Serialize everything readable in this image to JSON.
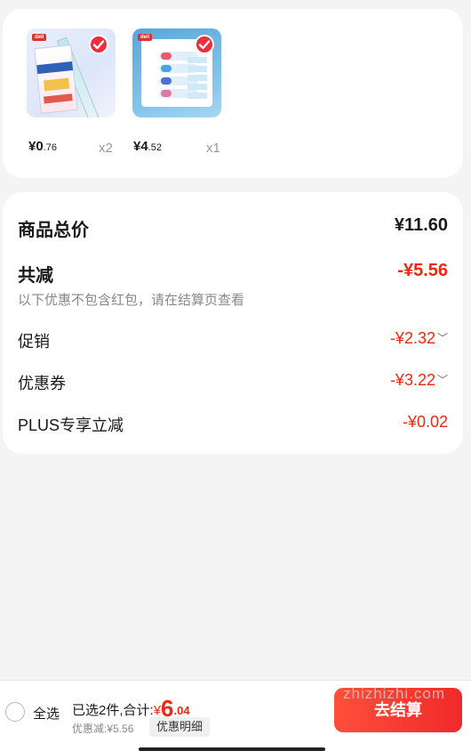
{
  "products": [
    {
      "price_symbol": "¥",
      "price_int": "0",
      "price_dec": ".76",
      "qty": "x2",
      "image": "ruler-set-product",
      "brand": "deli"
    },
    {
      "price_symbol": "¥",
      "price_int": "4",
      "price_dec": ".52",
      "qty": "x1",
      "image": "correction-tape-product",
      "brand": "deli"
    }
  ],
  "summary": {
    "total_label": "商品总价",
    "total_value": "¥11.60",
    "reduce_label": "共减",
    "reduce_value": "-¥5.56",
    "note": "以下优惠不包含红包，请在结算页查看",
    "promo_label": "促销",
    "promo_value": "-¥2.32",
    "coupon_label": "优惠券",
    "coupon_value": "-¥3.22",
    "plus_label": "PLUS专享立减",
    "plus_value": "-¥0.02"
  },
  "bottom": {
    "select_all": "全选",
    "selected_prefix": "已选2件,合计:",
    "total_symbol": "¥",
    "total_int": "6",
    "total_dec": ".04",
    "discount_text": "优惠减:¥5.56",
    "detail_button": "优惠明细",
    "checkout_button": "去结算"
  },
  "watermark": "zhizhizhi.com",
  "colors": {
    "accent": "#f2270c",
    "background": "#f4f4f4"
  }
}
